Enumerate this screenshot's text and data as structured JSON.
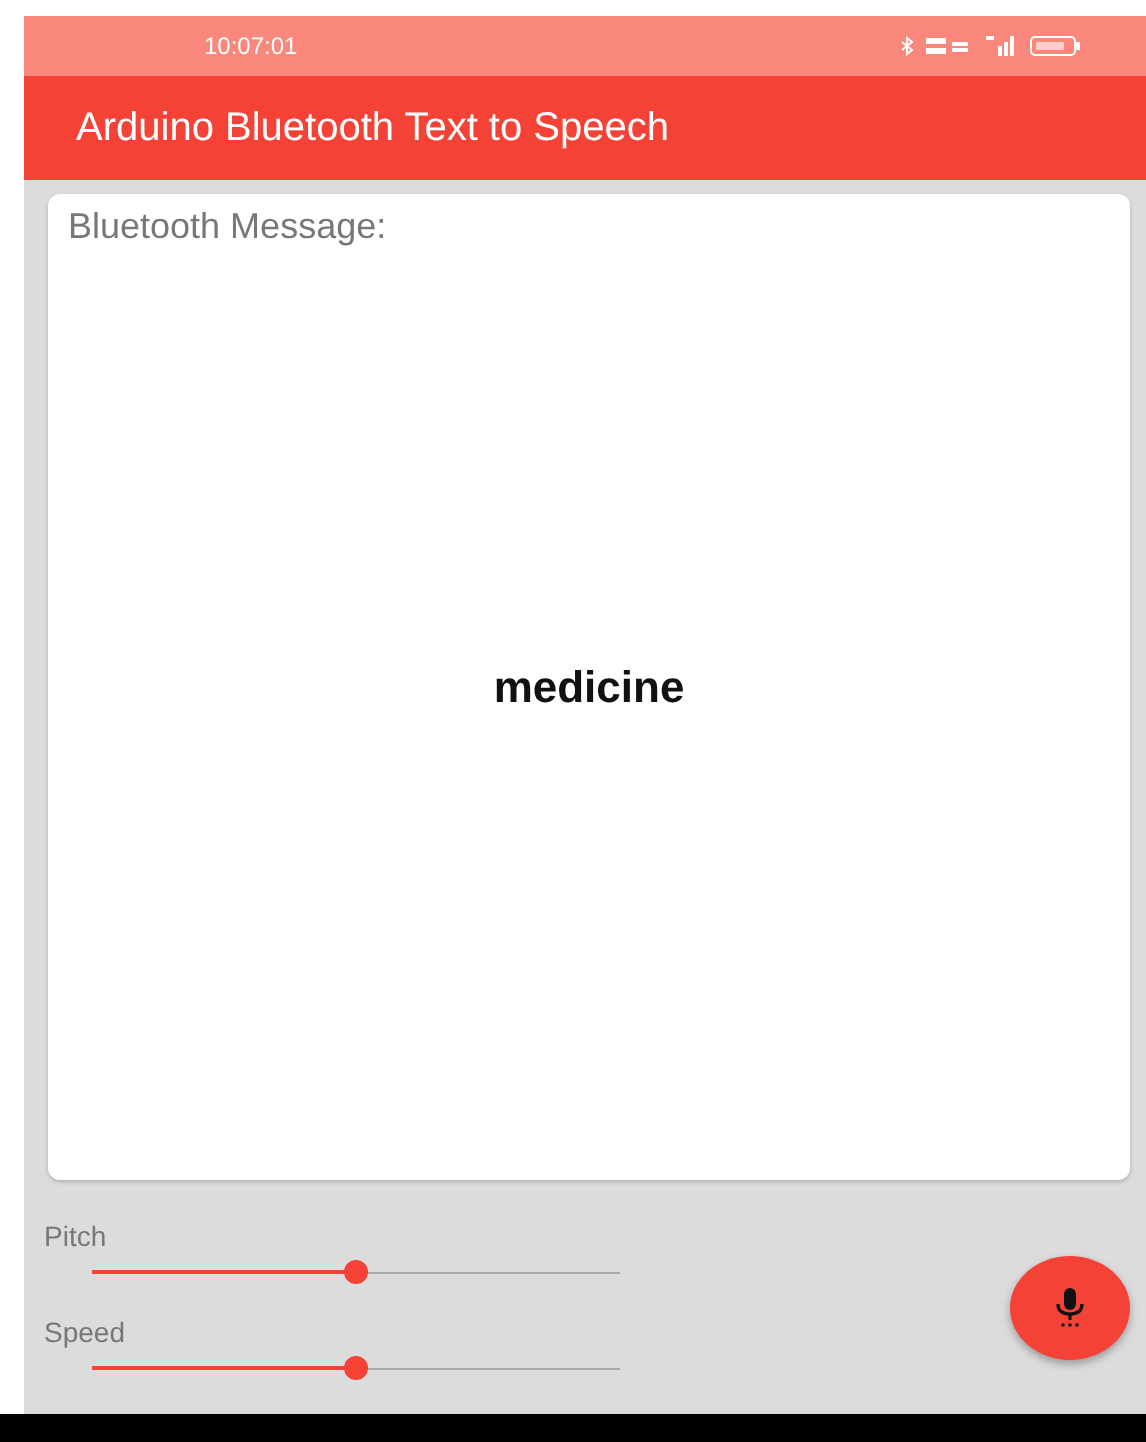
{
  "status_bar": {
    "time": "10:07:01"
  },
  "app_bar": {
    "title": "Arduino Bluetooth Text to Speech"
  },
  "message_card": {
    "label": "Bluetooth Message:",
    "message": "medicine"
  },
  "sliders": [
    {
      "label": "Pitch",
      "level": 0.5
    },
    {
      "label": "Speed",
      "level": 0.5
    }
  ]
}
